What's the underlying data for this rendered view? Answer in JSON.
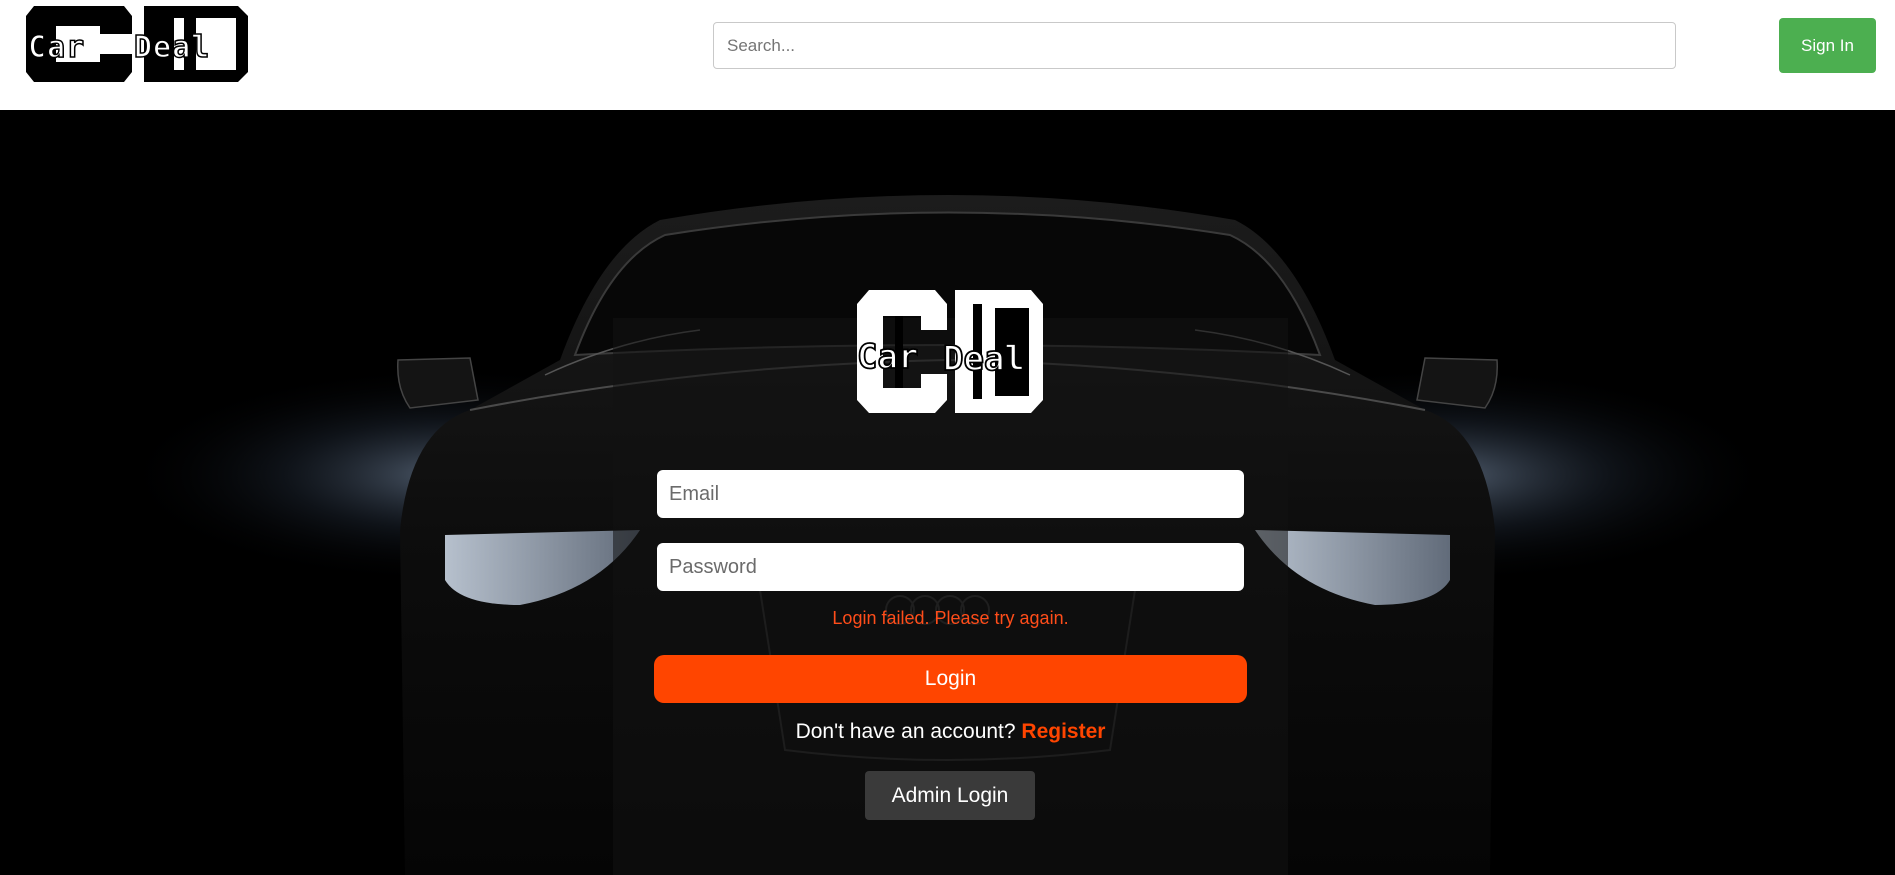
{
  "header": {
    "logo_text": "Car Deal",
    "search": {
      "placeholder": "Search...",
      "value": ""
    },
    "signin_label": "Sign In"
  },
  "login": {
    "logo_text": "Car Deal",
    "email": {
      "placeholder": "Email",
      "value": ""
    },
    "password": {
      "placeholder": "Password",
      "value": ""
    },
    "error_message": "Login failed. Please try again.",
    "login_label": "Login",
    "register_prompt": "Don't have an account?",
    "register_label": "Register",
    "admin_login_label": "Admin Login"
  },
  "colors": {
    "accent": "#ff4500",
    "signin": "#4caf50",
    "error": "#ff4d1a",
    "admin_button": "#3a3a3a"
  },
  "icons": {
    "brand_logo": "car-deal-logo",
    "hero_image": "black-sedan-front-headlights"
  }
}
